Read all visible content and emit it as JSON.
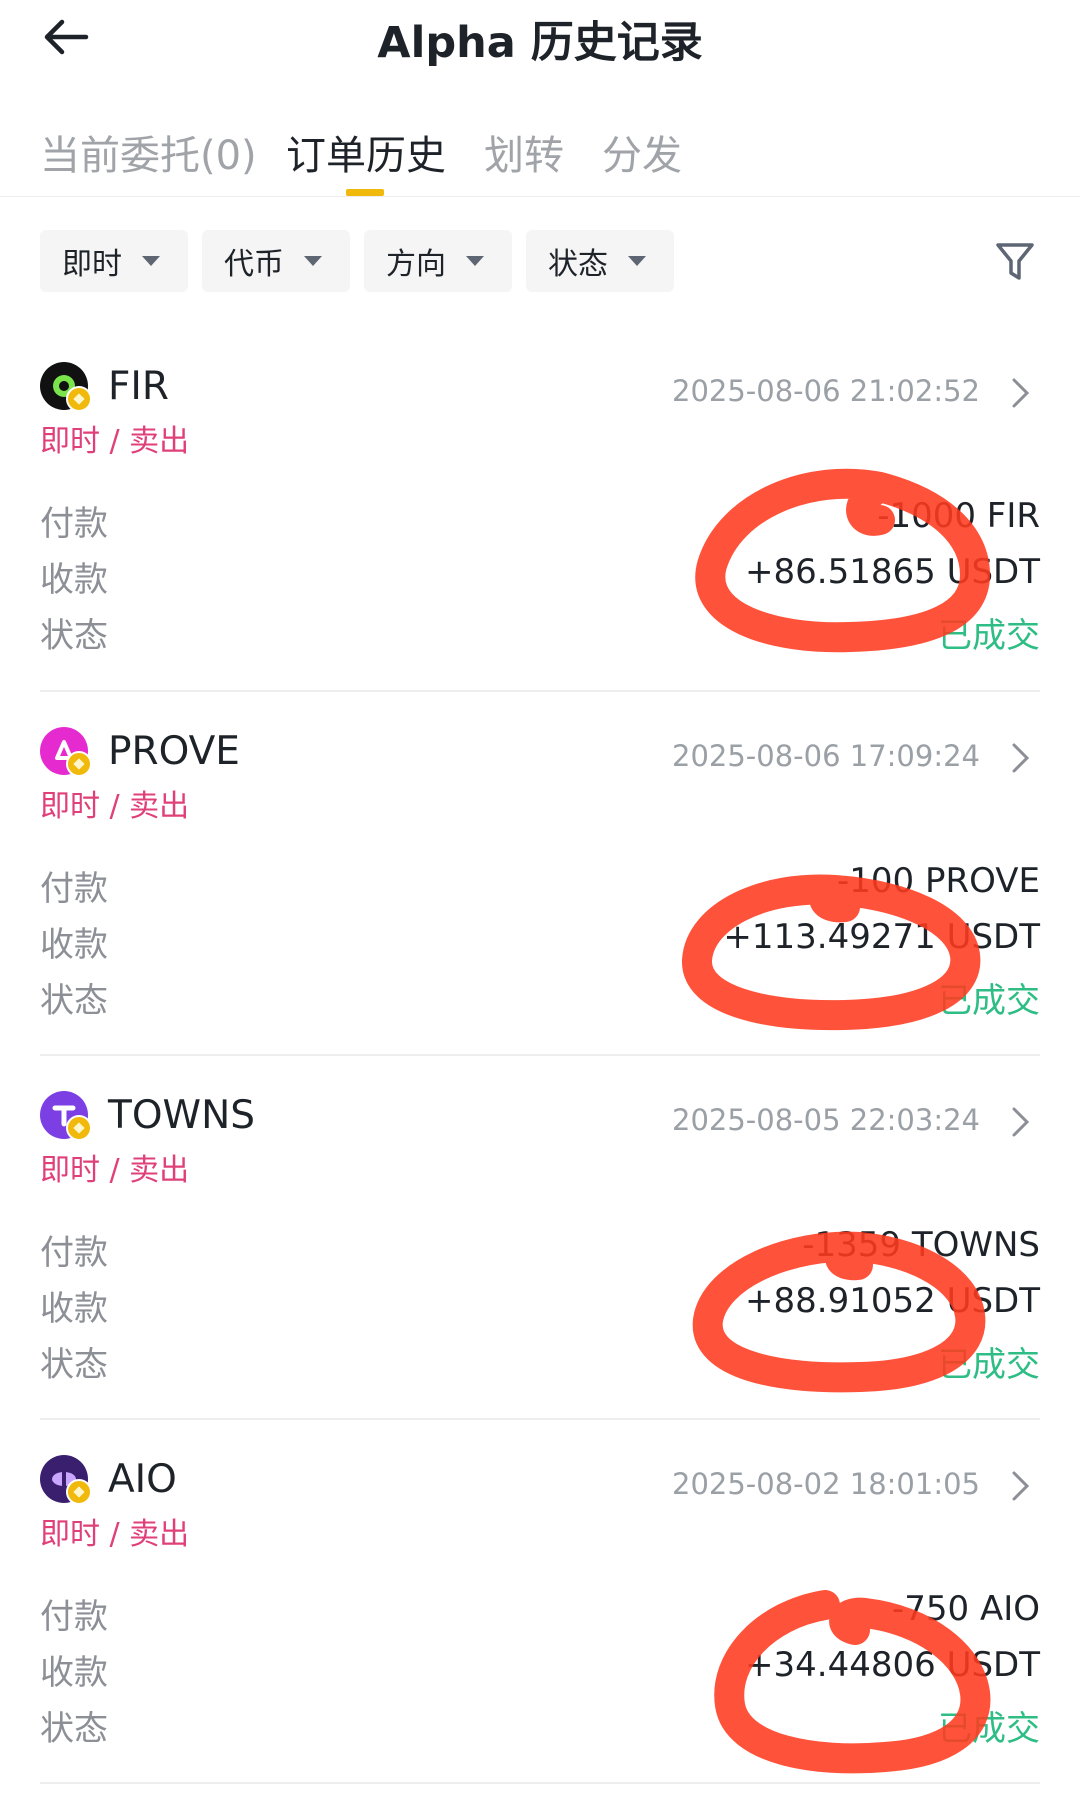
{
  "header": {
    "title": "Alpha 历史记录"
  },
  "tabs": [
    {
      "label": "当前委托(0)",
      "active": false
    },
    {
      "label": "订单历史",
      "active": true
    },
    {
      "label": "划转",
      "active": false
    },
    {
      "label": "分发",
      "active": false
    }
  ],
  "filters": [
    {
      "label": "即时"
    },
    {
      "label": "代币"
    },
    {
      "label": "方向"
    },
    {
      "label": "状态"
    }
  ],
  "labels": {
    "pay": "付款",
    "receive": "收款",
    "status": "状态"
  },
  "orders": [
    {
      "coin": "FIR",
      "time": "2025-08-06 21:02:52",
      "type": "即时 / 卖出",
      "pay": "-1000 FIR",
      "receive": "+86.51865 USDT",
      "status": "已成交",
      "logo_color": "#111111"
    },
    {
      "coin": "PROVE",
      "time": "2025-08-06 17:09:24",
      "type": "即时 / 卖出",
      "pay": "-100 PROVE",
      "receive": "+113.49271 USDT",
      "status": "已成交",
      "logo_color": "#e52bd0"
    },
    {
      "coin": "TOWNS",
      "time": "2025-08-05 22:03:24",
      "type": "即时 / 卖出",
      "pay": "-1359 TOWNS",
      "receive": "+88.91052 USDT",
      "status": "已成交",
      "logo_color": "#7b3fe4"
    },
    {
      "coin": "AIO",
      "time": "2025-08-02 18:01:05",
      "type": "即时 / 卖出",
      "pay": "-750 AIO",
      "receive": "+34.44806 USDT",
      "status": "已成交",
      "logo_color": "#3a1f6e"
    }
  ],
  "colors": {
    "accent": "#f0b90b",
    "sell": "#e0407a",
    "filled": "#2ebd85",
    "annotation": "#ff3a1f"
  }
}
